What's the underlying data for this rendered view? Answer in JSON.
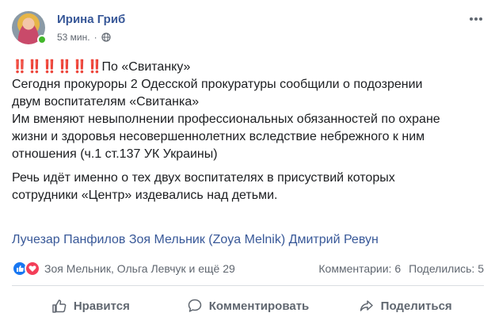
{
  "post": {
    "author": "Ирина Гриб",
    "time": "53 мин.",
    "marks": "‼️‼️‼️‼️‼️‼️",
    "headline": "По «Свитанку»",
    "paragraph1_line1": "Сегодня прокуроры 2 Одесской прокуратуры сообщили о подозрении",
    "paragraph1_line2": "двум воспитателям «Свитанка»",
    "paragraph1_line3": "Им вменяют невыполнении профессиональных обязанностей по охране",
    "paragraph1_line4": "жизни и здоровья несовершеннолетних вследствие небрежного к ним",
    "paragraph1_line5": "отношения (ч.1 ст.137 УК Украины)",
    "paragraph2_line1": "Речь идёт именно о тех двух воспитателях в присуствий которых",
    "paragraph2_line2": "сотрудники «Центр» издевались над детьми.",
    "tags": [
      "Лучезар Панфилов",
      "Зоя Мельник (Zoya Melnik)",
      "Дмитрий Ревун"
    ]
  },
  "reactions": {
    "names": "Зоя Мельник, Ольга Левчук и ещё 29",
    "comments": "Комментарии: 6",
    "shares": "Поделились: 5"
  },
  "actions": {
    "like": "Нравится",
    "comment": "Комментировать",
    "share": "Поделиться"
  },
  "colors": {
    "link": "#385898",
    "marks": "#d9262c",
    "like_reaction": "#1877f2",
    "love_reaction": "#f33e58",
    "online": "#42b72a"
  }
}
